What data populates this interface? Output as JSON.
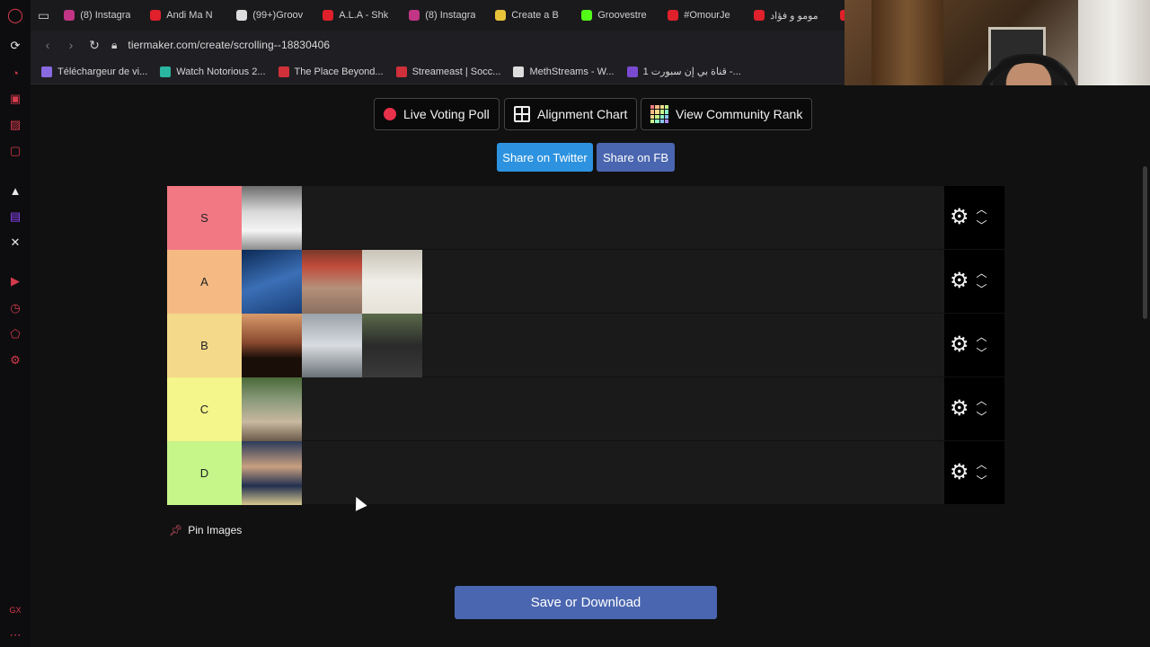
{
  "browser": {
    "tabs": [
      {
        "label": "(8) Instagra",
        "icon": "instagram-icon",
        "color": "#c13584"
      },
      {
        "label": "Andi Ma N",
        "icon": "youtube-icon",
        "color": "#e0202a"
      },
      {
        "label": "(99+)Groov",
        "icon": "tiktok-icon",
        "color": "#dddddd"
      },
      {
        "label": "A.L.A - Shk",
        "icon": "youtube-icon",
        "color": "#e0202a"
      },
      {
        "label": "(8) Instagra",
        "icon": "instagram-icon",
        "color": "#c13584"
      },
      {
        "label": "Create a B",
        "icon": "tiermaker-icon",
        "color": "#e8c33a"
      },
      {
        "label": "Groovestre",
        "icon": "kick-icon",
        "color": "#53fc18"
      },
      {
        "label": "#OmourJe",
        "icon": "youtube-icon",
        "color": "#e0202a"
      },
      {
        "label": "مومو و فؤاد",
        "icon": "youtube-icon",
        "color": "#e0202a"
      },
      {
        "label": "#",
        "icon": "youtube-icon",
        "color": "#e0202a"
      }
    ],
    "url": "tiermaker.com/create/scrolling--18830406",
    "bookmarks": [
      {
        "label": "Téléchargeur de vi...",
        "color": "#8a6ae0"
      },
      {
        "label": "Watch Notorious 2...",
        "color": "#2ab5a0"
      },
      {
        "label": "The Place Beyond...",
        "color": "#d0303a"
      },
      {
        "label": "Streameast | Socc...",
        "color": "#d0303a"
      },
      {
        "label": "MethStreams - W...",
        "color": "#dddddd",
        "glyph": "M"
      },
      {
        "label": "قناة بي إن سبورت 1 -...",
        "color": "#7a4ad0"
      }
    ]
  },
  "toolbar": {
    "live_voting": "Live Voting Poll",
    "alignment_chart": "Alignment Chart",
    "community_rank": "View Community Rank",
    "share_twitter": "Share on Twitter",
    "share_fb": "Share on FB"
  },
  "tiers": [
    {
      "label": "S",
      "color": "#f27883",
      "items": [
        {
          "name": "toilet",
          "bg": "linear-gradient(180deg,#6d6d6d,#d8d8d8 40%,#f4f4f4 70%,#8c8c8c)"
        }
      ]
    },
    {
      "label": "A",
      "color": "#f5ba83",
      "items": [
        {
          "name": "woman-sleeping",
          "bg": "linear-gradient(160deg,#0c2a55,#3b6fb6 50%,#1a3f78)"
        },
        {
          "name": "street-shop",
          "bg": "linear-gradient(180deg,#7a3a2a,#c04a3a 25%,#b5907a 60%,#8a7060)"
        },
        {
          "name": "man-in-bed",
          "bg": "linear-gradient(180deg,#c9c4b8,#f0eee8 50%,#e6e2d8)"
        }
      ]
    },
    {
      "label": "B",
      "color": "#f4d98a",
      "items": [
        {
          "name": "couple-dinner",
          "bg": "linear-gradient(180deg,#d89a6a,#8a4a30 45%,#1a0e08 70%)"
        },
        {
          "name": "worker-flooring",
          "bg": "linear-gradient(180deg,#9aa2aa,#d8dce0 50%,#6a7278)"
        },
        {
          "name": "group-suits",
          "bg": "linear-gradient(180deg,#5a6a4a,#2a2a2a 50%,#3a3a3a)"
        }
      ]
    },
    {
      "label": "C",
      "color": "#f4f58a",
      "items": [
        {
          "name": "classroom",
          "bg": "linear-gradient(180deg,#4a6a3a,#8a9a7a 35%,#c8b8a0 70%,#6a5a4a)"
        }
      ]
    },
    {
      "label": "D",
      "color": "#c6f58a",
      "items": [
        {
          "name": "man-eating",
          "bg": "linear-gradient(180deg,#2a3a5a,#c8a080 40%,#223050 70%,#d8c890)"
        }
      ]
    }
  ],
  "pin_label": "Pin Images",
  "save_label": "Save or Download"
}
